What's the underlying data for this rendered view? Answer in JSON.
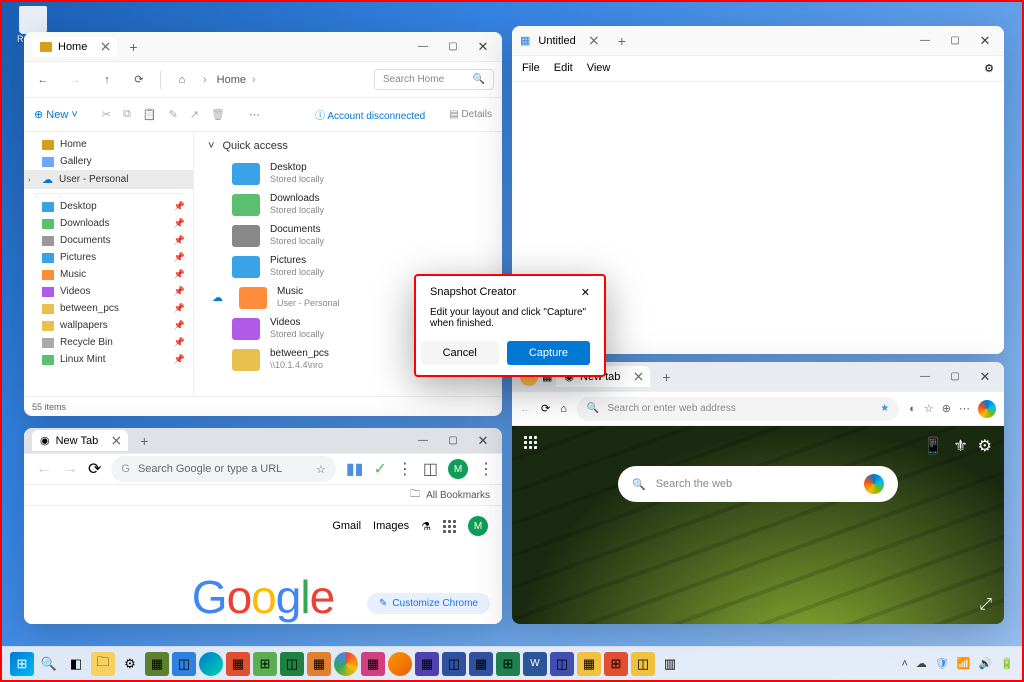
{
  "desktop": {
    "recycle_bin": "Recycle Bin"
  },
  "explorer": {
    "tab_title": "Home",
    "breadcrumb": "Home",
    "search_placeholder": "Search Home",
    "new_label": "New",
    "account_status": "Account disconnected",
    "details_label": "Details",
    "nav": {
      "home": "Home",
      "gallery": "Gallery",
      "user": "User - Personal",
      "desktop": "Desktop",
      "downloads": "Downloads",
      "documents": "Documents",
      "pictures": "Pictures",
      "music": "Music",
      "videos": "Videos",
      "between": "between_pcs",
      "wallpapers": "wallpapers",
      "recycle": "Recycle Bin",
      "mint": "Linux Mint"
    },
    "quick_access": "Quick access",
    "qa_items": [
      {
        "name": "Desktop",
        "sub": "Stored locally"
      },
      {
        "name": "Downloads",
        "sub": "Stored locally"
      },
      {
        "name": "Documents",
        "sub": "Stored locally"
      },
      {
        "name": "Pictures",
        "sub": "Stored locally"
      },
      {
        "name": "Music",
        "sub": "User - Personal"
      },
      {
        "name": "Videos",
        "sub": "Stored locally"
      },
      {
        "name": "between_pcs",
        "sub": "\\\\10.1.4.4\\nro"
      }
    ],
    "status": "55 items"
  },
  "notepad": {
    "tab_title": "Untitled",
    "menu": {
      "file": "File",
      "edit": "Edit",
      "view": "View"
    }
  },
  "chrome": {
    "tab_title": "New Tab",
    "omnibox": "Search Google or type a URL",
    "bookmarks": "All Bookmarks",
    "shortcuts": {
      "gmail": "Gmail",
      "images": "Images"
    },
    "avatar": "M",
    "customize": "Customize Chrome"
  },
  "edge": {
    "tab_title": "New tab",
    "omnibox": "Search or enter web address",
    "searchbox": "Search the web"
  },
  "dialog": {
    "title": "Snapshot Creator",
    "message": "Edit your layout and click \"Capture\" when finished.",
    "cancel": "Cancel",
    "capture": "Capture"
  }
}
